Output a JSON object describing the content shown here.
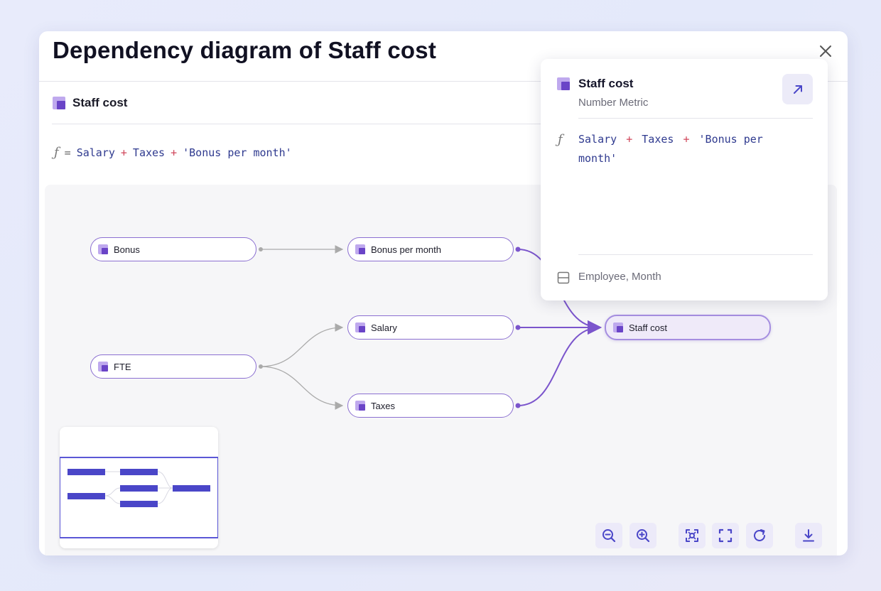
{
  "modal": {
    "title": "Dependency diagram of Staff cost"
  },
  "metric": {
    "name": "Staff cost",
    "formula": {
      "terms": [
        "Salary",
        "Taxes",
        "'Bonus per month'"
      ],
      "operator": "+",
      "equals": "="
    }
  },
  "nodes": {
    "bonus": "Bonus",
    "bonus_per_month": "Bonus per month",
    "fte": "FTE",
    "salary": "Salary",
    "taxes": "Taxes",
    "staff_cost": "Staff cost"
  },
  "popover": {
    "title": "Staff cost",
    "subtitle": "Number Metric",
    "formula_line1_terms": [
      "Salary",
      "Taxes",
      "'Bonus per"
    ],
    "formula_line2": "month'",
    "dimensions": "Employee, Month"
  },
  "icons": {
    "metric": "metric-icon",
    "function": "function-icon",
    "close": "close-icon",
    "open": "arrow-up-right-icon",
    "dimensions": "table-icon",
    "toolbar": [
      "zoom-out-icon",
      "zoom-in-icon",
      "focus-icon",
      "fullscreen-icon",
      "refresh-icon",
      "download-icon"
    ]
  },
  "colors": {
    "accent": "#6a44c7",
    "node_border": "#8b6fd1",
    "edge_active": "#7b55cc",
    "edge_inactive": "#aaaaaa",
    "formula_text": "#2f3a8f",
    "formula_operator": "#d0465a",
    "minimap_bar": "#4a46c8"
  }
}
